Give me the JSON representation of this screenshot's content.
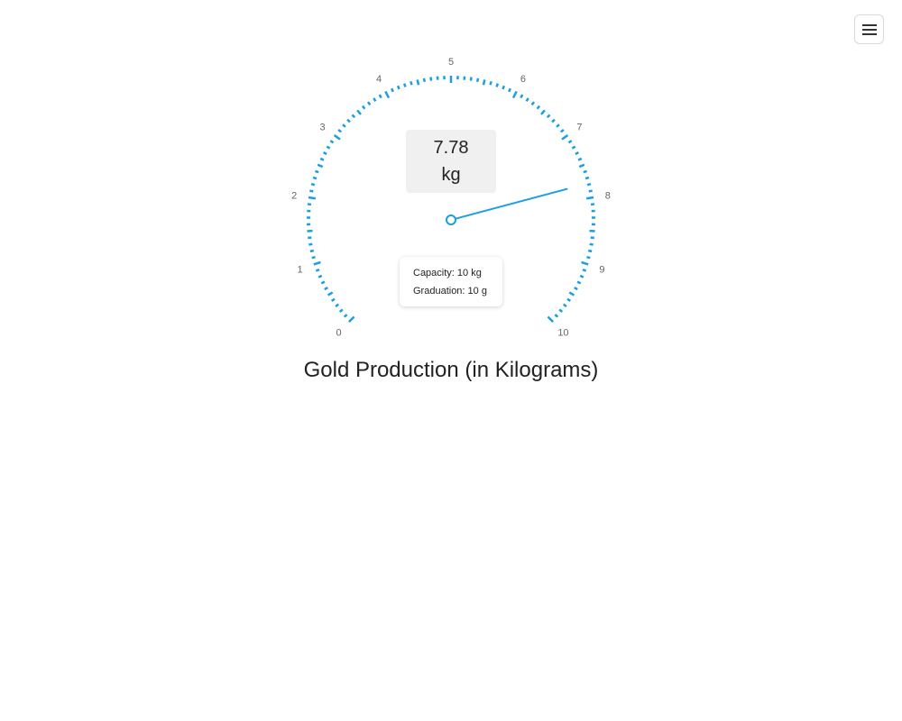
{
  "menu": {
    "icon": "hamburger-menu-icon"
  },
  "chart_data": {
    "type": "gauge",
    "title": "Gold Production (in Kilograms)",
    "min": 0,
    "max": 10,
    "value": 7.78,
    "value_display": "7.78",
    "unit": "kg",
    "major_ticks": [
      "0",
      "1",
      "2",
      "3",
      "4",
      "5",
      "6",
      "7",
      "8",
      "9",
      "10"
    ],
    "minor_ticks_per_major": 10,
    "info": {
      "capacity": "Capacity: 10 kg",
      "graduation": "Graduation: 10 g"
    },
    "colors": {
      "scale": "#1a9fe0",
      "needle": "#1a9fe0",
      "label": "#666666"
    }
  }
}
